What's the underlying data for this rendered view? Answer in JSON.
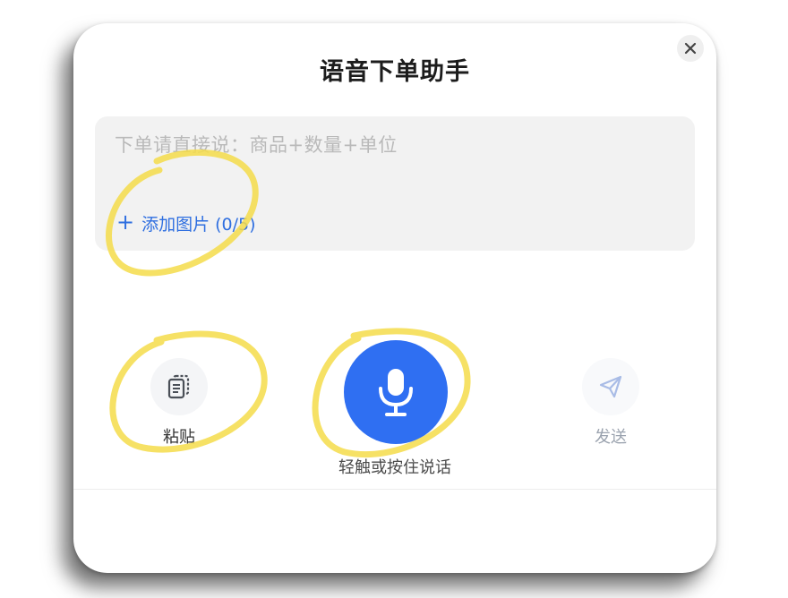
{
  "dialog": {
    "title": "语音下单助手",
    "close_icon": "close-icon"
  },
  "input": {
    "placeholder": "下单请直接说：商品+数量+单位",
    "add_image_label": "添加图片 (0/5)",
    "add_icon": "plus-icon"
  },
  "actions": {
    "paste_label": "粘贴",
    "paste_icon": "clipboard-icon",
    "mic_label": "轻触或按住说话",
    "mic_icon": "microphone-icon",
    "send_label": "发送",
    "send_icon": "paper-plane-icon"
  },
  "colors": {
    "accent": "#2f6ff2",
    "link": "#2f6fe0",
    "highlight_marker": "#f5dc4a"
  }
}
